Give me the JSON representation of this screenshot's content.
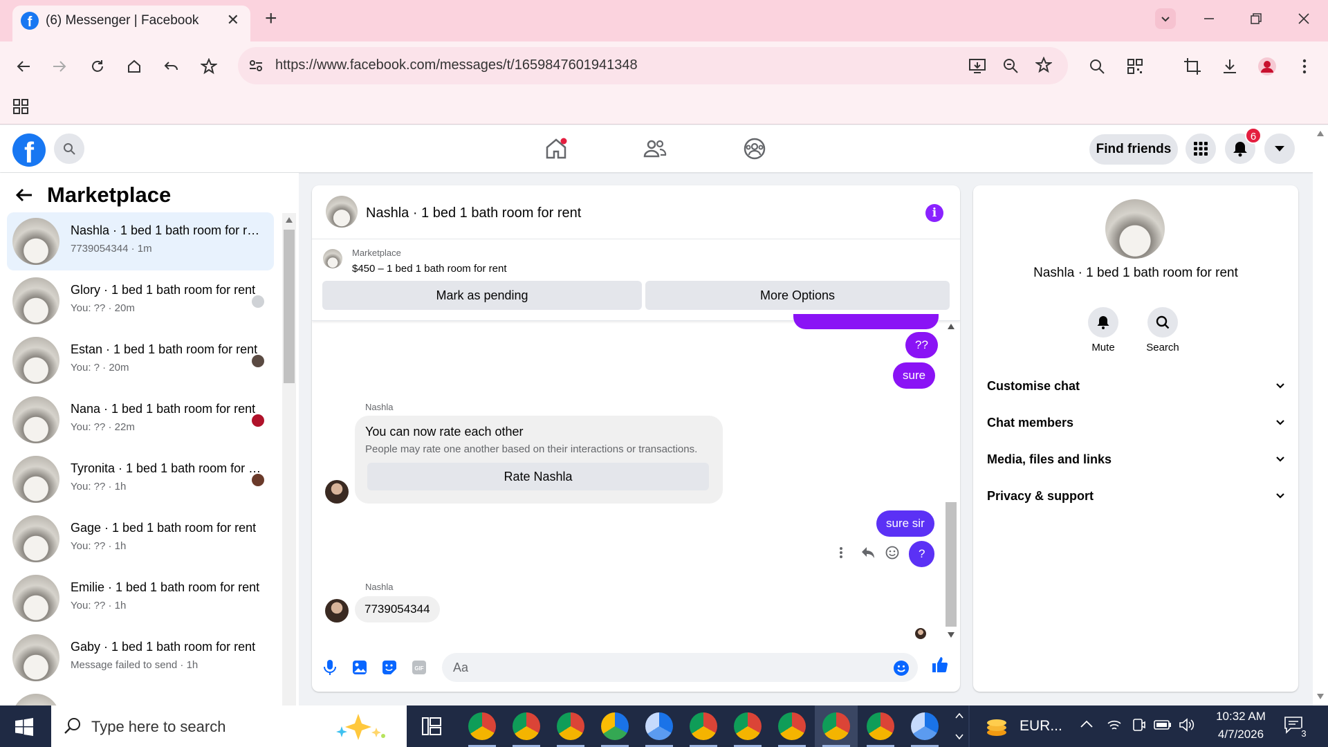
{
  "browser": {
    "tab_title": "(6) Messenger | Facebook",
    "url": "https://www.facebook.com/messages/t/1659847601941348"
  },
  "header": {
    "find_friends": "Find friends",
    "notification_count": "6"
  },
  "left": {
    "title": "Marketplace",
    "conversations": [
      {
        "name": "Nashla · 1 bed 1 bath room for rent",
        "sub": "7739054344 · 1m"
      },
      {
        "name": "Glory · 1 bed 1 bath room for rent",
        "sub": "You: ?? · 20m"
      },
      {
        "name": "Estan · 1 bed 1 bath room for rent",
        "sub": "You: ? · 20m"
      },
      {
        "name": "Nana · 1 bed 1 bath room for rent",
        "sub": "You: ?? · 22m"
      },
      {
        "name": "Tyronita · 1 bed 1 bath room for rent",
        "sub": "You: ?? · 1h"
      },
      {
        "name": "Gage · 1 bed 1 bath room for rent",
        "sub": "You: ?? · 1h"
      },
      {
        "name": "Emilie · 1 bed 1 bath room for rent",
        "sub": "You: ?? · 1h"
      },
      {
        "name": "Gaby · 1 bed 1 bath room for rent",
        "sub": "Message failed to send · 1h"
      }
    ]
  },
  "chat": {
    "title": "Nashla · 1 bed 1 bath room for rent",
    "marketplace_label": "Marketplace",
    "listing": "$450 – 1 bed 1 bath room for rent",
    "mark_pending": "Mark as pending",
    "more_options": "More Options",
    "msg_q2": "??",
    "msg_sure": "sure",
    "sender1": "Nashla",
    "rate_title": "You can now rate each other",
    "rate_desc": "People may rate one another based on their interactions or transactions.",
    "rate_button": "Rate Nashla",
    "msg_sure_sir": "sure sir",
    "msg_q1": "?",
    "sender2": "Nashla",
    "msg_phone": "7739054344",
    "input_placeholder": "Aa"
  },
  "right": {
    "title": "Nashla · 1 bed 1 bath room for rent",
    "mute": "Mute",
    "search": "Search",
    "sections": [
      "Customise chat",
      "Chat members",
      "Media, files and links",
      "Privacy & support"
    ]
  },
  "taskbar": {
    "search_placeholder": "Type here to search",
    "currency": "EUR...",
    "time": "10:32 AM",
    "date": "4/7/2026",
    "notif_count": "3"
  },
  "colors": {
    "fb_blue": "#1877f2",
    "my_bubble": "#8a13f5",
    "my_bubble_2": "#5b31f5",
    "tab_pink": "#fbd3de"
  }
}
